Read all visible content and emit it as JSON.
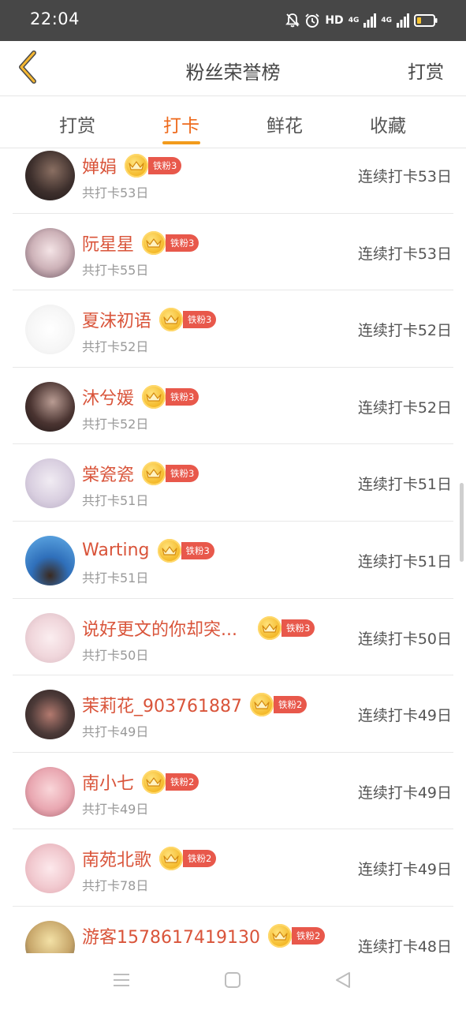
{
  "status_bar": {
    "time": "22:04",
    "hd_label": "HD",
    "network_1": "4G",
    "network_2": "4G"
  },
  "header": {
    "title": "粉丝荣誉榜",
    "action_label": "打赏"
  },
  "tabs": [
    {
      "label": "打赏",
      "active": false
    },
    {
      "label": "打卡",
      "active": true
    },
    {
      "label": "鲜花",
      "active": false
    },
    {
      "label": "收藏",
      "active": false
    }
  ],
  "colors": {
    "accent": "#ee6a1c",
    "name": "#d9543a",
    "badge": "#e8584b",
    "status_bar": "#474747"
  },
  "fans": [
    {
      "name": "婵娟",
      "badge": "铁粉3",
      "total": "共打卡53日",
      "streak": "连续打卡53日"
    },
    {
      "name": "阮星星",
      "badge": "铁粉3",
      "total": "共打卡55日",
      "streak": "连续打卡53日"
    },
    {
      "name": "夏沫初语",
      "badge": "铁粉3",
      "total": "共打卡52日",
      "streak": "连续打卡52日"
    },
    {
      "name": "沐兮媛",
      "badge": "铁粉3",
      "total": "共打卡52日",
      "streak": "连续打卡52日"
    },
    {
      "name": "棠瓷瓷",
      "badge": "铁粉3",
      "total": "共打卡51日",
      "streak": "连续打卡51日"
    },
    {
      "name": "Warting",
      "badge": "铁粉3",
      "total": "共打卡51日",
      "streak": "连续打卡51日"
    },
    {
      "name": "说好更文的你却突...",
      "badge": "铁粉3",
      "total": "共打卡50日",
      "streak": "连续打卡50日"
    },
    {
      "name": "茉莉花_903761887",
      "badge": "铁粉2",
      "total": "共打卡49日",
      "streak": "连续打卡49日"
    },
    {
      "name": "南小七",
      "badge": "铁粉2",
      "total": "共打卡49日",
      "streak": "连续打卡49日"
    },
    {
      "name": "南苑北歌",
      "badge": "铁粉2",
      "total": "共打卡78日",
      "streak": "连续打卡49日"
    },
    {
      "name": "游客1578617419130",
      "badge": "铁粉2",
      "total": "",
      "streak": "连续打卡48日"
    }
  ]
}
